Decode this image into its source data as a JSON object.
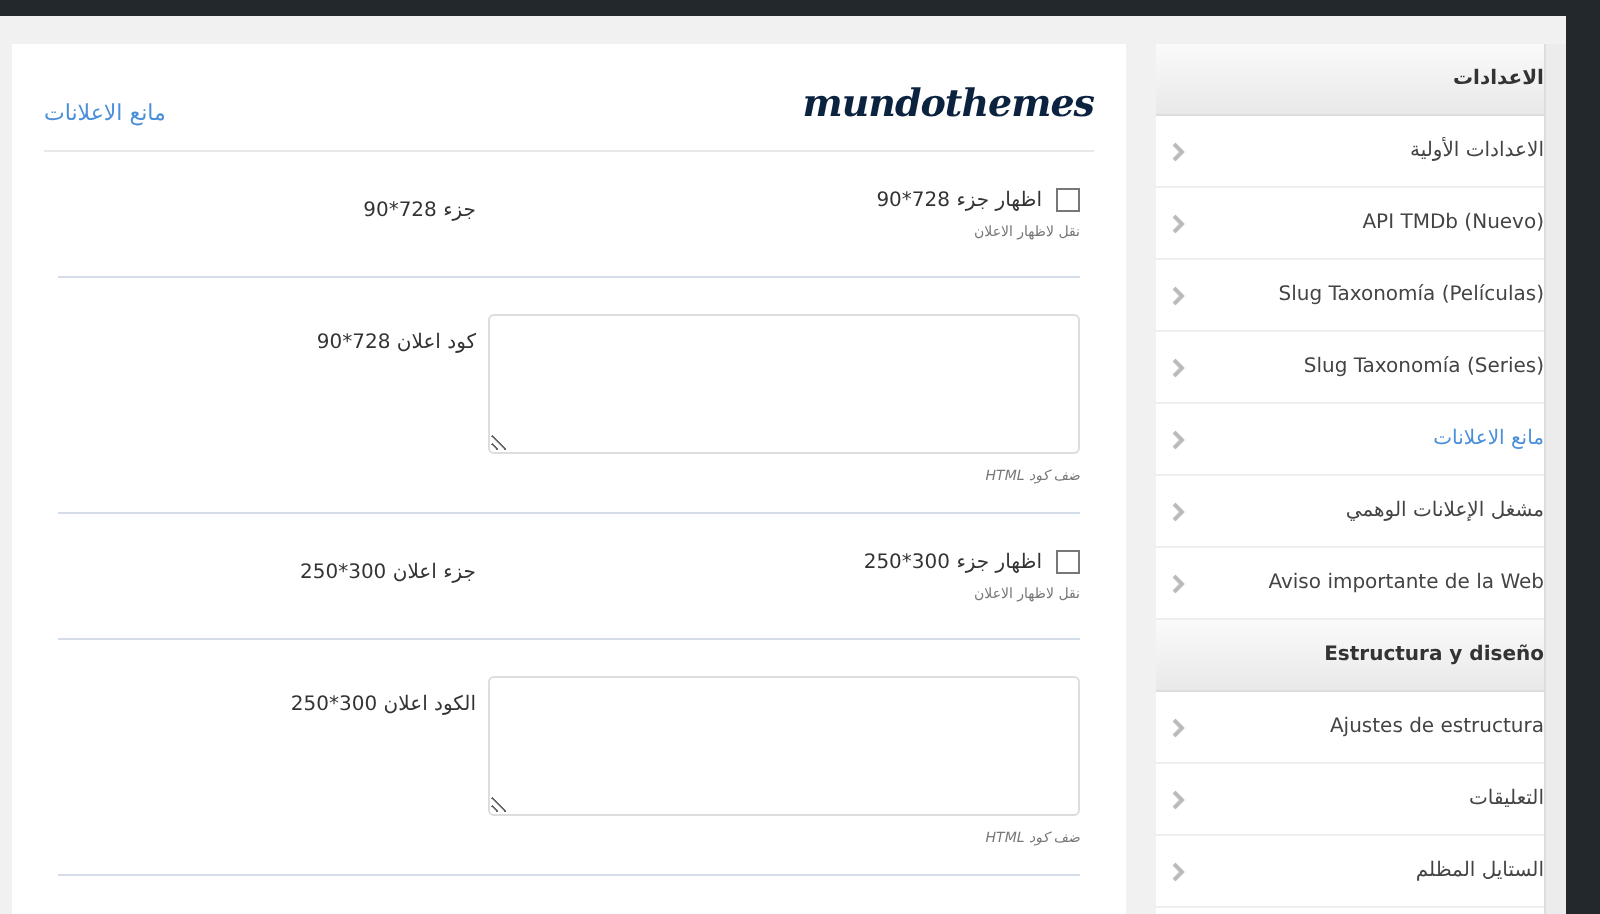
{
  "panel": {
    "logo": "mundothemes",
    "title": "مانع الاعلانات"
  },
  "fields": [
    {
      "kind": "checkbox",
      "label": "جزء 728*90",
      "option": "اظهار جزء 728*90",
      "checked": false,
      "hint": "نقل لاظهار الاعلان"
    },
    {
      "kind": "textarea",
      "label": "كود اعلان 728*90",
      "hint": "ضف كود HTML"
    },
    {
      "kind": "checkbox",
      "label": "جزء اعلان 300*250",
      "option": "اظهار جزء 300*250",
      "checked": false,
      "hint": "نقل لاظهار الاعلان"
    },
    {
      "kind": "textarea",
      "label": "الكود اعلان 300*250",
      "hint": "ضف كود HTML"
    }
  ],
  "sidebar": {
    "items": [
      {
        "kind": "heading",
        "label": "الاعدادات"
      },
      {
        "kind": "item",
        "label": "الاعدادات الأولية",
        "selected": false
      },
      {
        "kind": "item",
        "label": "API TMDb (Nuevo)",
        "selected": false
      },
      {
        "kind": "item",
        "label": "Slug Taxonomía (Películas)",
        "selected": false
      },
      {
        "kind": "item",
        "label": "Slug Taxonomía (Series)",
        "selected": false
      },
      {
        "kind": "item",
        "label": "مانع الاعلانات",
        "selected": true
      },
      {
        "kind": "item",
        "label": "مشغل الإعلانات الوهمي",
        "selected": false
      },
      {
        "kind": "item",
        "label": "Aviso importante de la Web",
        "selected": false
      },
      {
        "kind": "heading",
        "label": "Estructura y diseño"
      },
      {
        "kind": "item",
        "label": "Ajustes de estructura",
        "selected": false
      },
      {
        "kind": "item",
        "label": "التعليقات",
        "selected": false
      },
      {
        "kind": "item",
        "label": "الستايل المظلم",
        "selected": false
      }
    ]
  }
}
